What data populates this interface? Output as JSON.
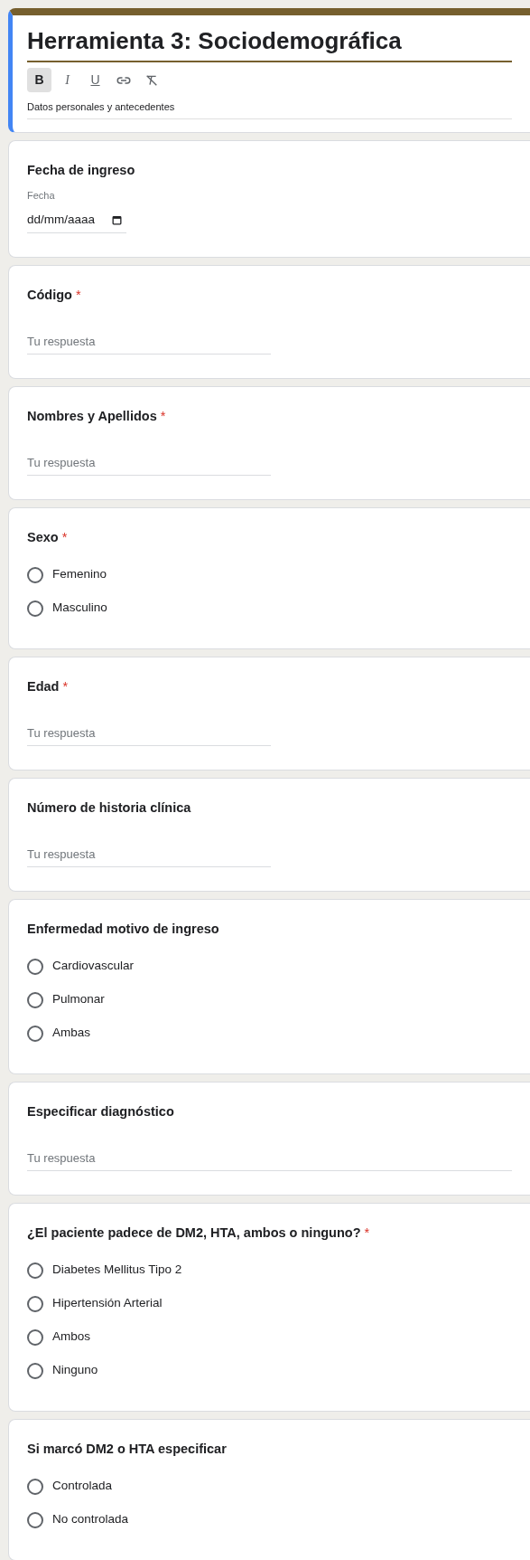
{
  "header": {
    "title": "Herramienta 3: Sociodemográfica",
    "toolbar": [
      {
        "kind": "bold",
        "label": "B",
        "selected": true
      },
      {
        "kind": "italic",
        "label": "I",
        "selected": false
      },
      {
        "kind": "underline",
        "label": "U",
        "selected": false
      },
      {
        "kind": "link",
        "selected": false
      },
      {
        "kind": "clear",
        "selected": false
      }
    ],
    "description": "Datos personales y antecedentes"
  },
  "questions": [
    {
      "kind": "date",
      "title": "Fecha de ingreso",
      "label": "Fecha",
      "value": "dd/mm/aaaa"
    },
    {
      "kind": "short",
      "title": "Código",
      "required_mark": "*",
      "placeholder": "Tu respuesta"
    },
    {
      "kind": "short",
      "title": "Nombres y Apellidos",
      "required_mark": "*",
      "placeholder": "Tu respuesta"
    },
    {
      "kind": "radio",
      "title": "Sexo",
      "required_mark": "*",
      "options": [
        {
          "label": "Femenino",
          "selected": false
        },
        {
          "label": "Masculino",
          "selected": false
        }
      ]
    },
    {
      "kind": "short",
      "title": "Edad",
      "required_mark": "*",
      "placeholder": "Tu respuesta"
    },
    {
      "kind": "short",
      "title": "Número de historia clínica",
      "placeholder": "Tu respuesta"
    },
    {
      "kind": "radio",
      "title": "Enfermedad motivo de ingreso",
      "options": [
        {
          "label": "Cardiovascular",
          "selected": false
        },
        {
          "label": "Pulmonar",
          "selected": false
        },
        {
          "label": "Ambas",
          "selected": false
        }
      ]
    },
    {
      "kind": "paragraph",
      "title": "Especificar diagnóstico",
      "placeholder": "Tu respuesta"
    },
    {
      "kind": "radio",
      "title": "¿El paciente padece de DM2, HTA, ambos o ninguno?",
      "required_mark": "*",
      "options": [
        {
          "label": "Diabetes Mellitus Tipo 2",
          "selected": false
        },
        {
          "label": "Hipertensión Arterial",
          "selected": false
        },
        {
          "label": "Ambos",
          "selected": false
        },
        {
          "label": "Ninguno",
          "selected": false
        }
      ]
    },
    {
      "kind": "radio",
      "title": "Si marcó DM2 o HTA especificar",
      "options": [
        {
          "label": "Controlada",
          "selected": false
        },
        {
          "label": "No controlada",
          "selected": false
        }
      ]
    }
  ]
}
